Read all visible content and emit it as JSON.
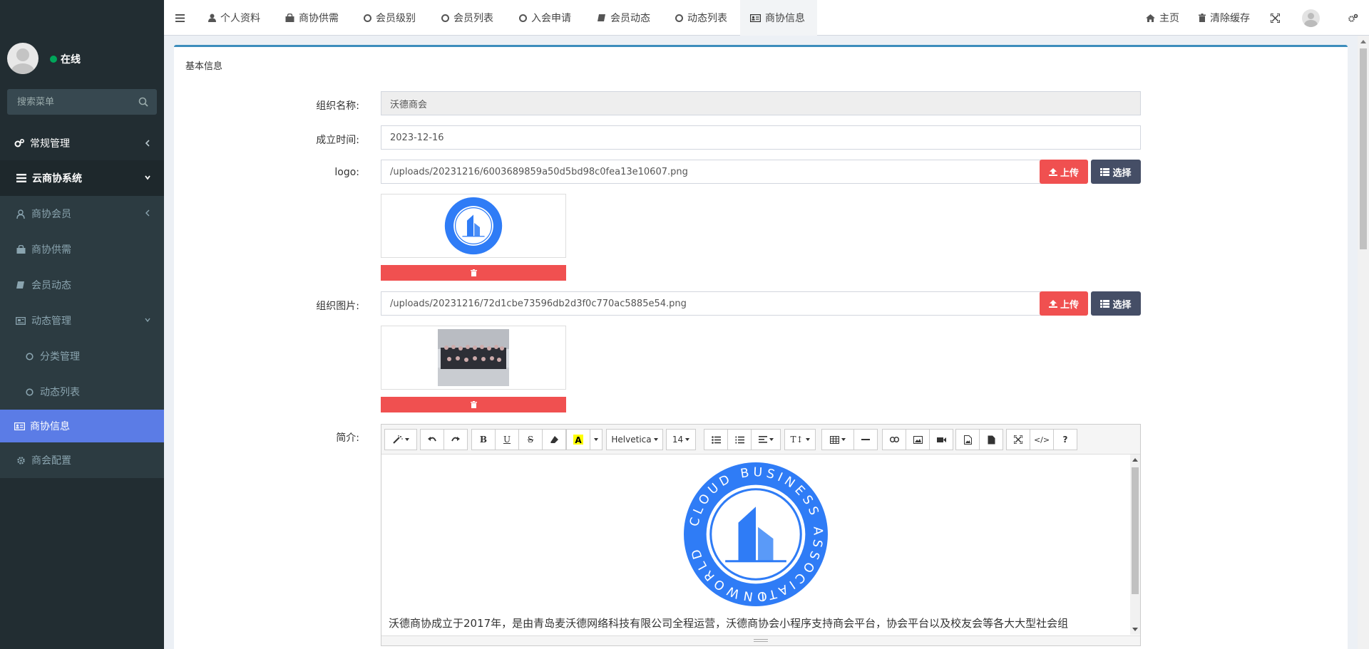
{
  "sidebar": {
    "status": "在线",
    "search_placeholder": "搜索菜单",
    "items": [
      {
        "label": "常规管理"
      },
      {
        "label": "云商协系统"
      },
      {
        "label": "商协会员"
      },
      {
        "label": "商协供需"
      },
      {
        "label": "会员动态"
      },
      {
        "label": "动态管理"
      },
      {
        "label": "分类管理"
      },
      {
        "label": "动态列表"
      },
      {
        "label": "商协信息"
      },
      {
        "label": "商会配置"
      }
    ]
  },
  "topbar": {
    "tabs": [
      {
        "label": "个人资料",
        "icon": "user-icon"
      },
      {
        "label": "商协供需",
        "icon": "shopping-bag-icon"
      },
      {
        "label": "会员级别",
        "icon": "circle-icon"
      },
      {
        "label": "会员列表",
        "icon": "circle-icon"
      },
      {
        "label": "入会申请",
        "icon": "circle-icon"
      },
      {
        "label": "会员动态",
        "icon": "book-icon"
      },
      {
        "label": "动态列表",
        "icon": "circle-icon"
      },
      {
        "label": "商协信息",
        "icon": "id-card-icon"
      }
    ],
    "home": "主页",
    "clear_cache": "清除缓存"
  },
  "panel": {
    "title": "基本信息"
  },
  "form": {
    "org_name_label": "组织名称:",
    "org_name_value": "沃德商会",
    "founded_label": "成立时间:",
    "founded_value": "2023-12-16",
    "logo_label": "logo:",
    "logo_value": "/uploads/20231216/6003689859a50d5bd98c0fea13e10607.png",
    "org_image_label": "组织图片:",
    "org_image_value": "/uploads/20231216/72d1cbe73596db2d3f0c770ac5885e54.png",
    "upload_label": "上传",
    "select_label": "选择",
    "intro_label": "简介:"
  },
  "logo_image": {
    "ring_text_top": "CLOUD BUSINESS ASSOCIATI",
    "ring_text_bottom": "ONWORLD"
  },
  "editor": {
    "font_name": "Helvetica",
    "font_size": "14",
    "content_text": "沃德商协成立于2017年，是由青岛麦沃德网络科技有限公司全程运营，沃德商协会小程序支持商会平台，协会平台以及校友会等各大大型社会组"
  },
  "colors": {
    "sidebar_bg": "#222d32",
    "active_menu": "#5b7ce6",
    "danger": "#f05050",
    "dark_button": "#454e66",
    "panel_accent": "#3c8dbc",
    "logo_blue": "#2f7cf6"
  }
}
